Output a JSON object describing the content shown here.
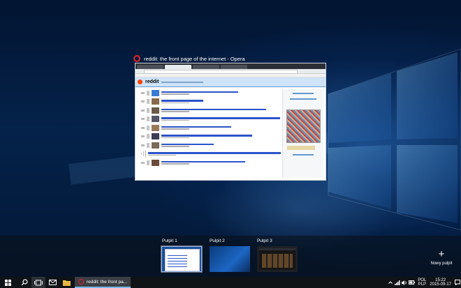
{
  "window": {
    "title": "reddit: the front page of the internet - Opera",
    "app_icon": "opera-icon"
  },
  "desktops": [
    {
      "label": "Pulpit 1",
      "active": true
    },
    {
      "label": "Pulpit 2",
      "active": false
    },
    {
      "label": "Pulpit 3",
      "active": false
    }
  ],
  "new_desktop": {
    "label": "Nowy pulpit",
    "icon": "plus-icon"
  },
  "taskbar": {
    "app_label": "reddit: the front pa...",
    "icons": [
      "windows-logo",
      "search-icon",
      "task-view-icon",
      "mail-icon",
      "file-explorer-icon",
      "opera-icon"
    ]
  },
  "tray": {
    "lang_top": "POL",
    "lang_bottom": "PLP",
    "time": "15:22",
    "date": "2015-09-17"
  },
  "colors": {
    "accent": "#76b9ed",
    "opera_red": "#e0232c"
  }
}
